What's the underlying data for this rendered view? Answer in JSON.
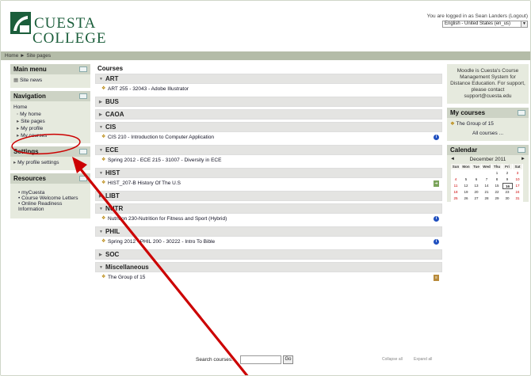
{
  "header": {
    "logo_text": "CUESTA COLLEGE",
    "login_info": "You are logged in as Sean Landers (Logout)",
    "language": "English - United States (en_us)"
  },
  "navbar": {
    "breadcrumb": "Home ► Site pages"
  },
  "main_menu": {
    "title": "Main menu",
    "items": [
      {
        "label": "Site news"
      }
    ]
  },
  "navigation": {
    "title": "Navigation",
    "home": "Home",
    "items": [
      "My home",
      "Site pages",
      "My profile",
      "My courses"
    ]
  },
  "settings": {
    "title": "Settings",
    "items": [
      "My profile settings"
    ]
  },
  "resources": {
    "title": "Resources",
    "items": [
      "myCuesta",
      "Course Welcome Letters",
      "Online Readiness Information"
    ]
  },
  "center": {
    "title": "Courses",
    "categories": [
      {
        "name": "ART",
        "expanded": true,
        "courses": [
          {
            "name": "ART 255 - 32043 - Adobe Illustrator",
            "icon": ""
          }
        ]
      },
      {
        "name": "BUS",
        "expanded": false,
        "courses": []
      },
      {
        "name": "CAOA",
        "expanded": false,
        "courses": []
      },
      {
        "name": "CIS",
        "expanded": true,
        "courses": [
          {
            "name": "CIS 210 - Introduction to Computer Application",
            "icon": "info"
          }
        ]
      },
      {
        "name": "ECE",
        "expanded": true,
        "courses": [
          {
            "name": "Spring 2012 - ECE 215 - 31007 - Diversity in ECE",
            "icon": ""
          }
        ]
      },
      {
        "name": "HIST",
        "expanded": true,
        "courses": [
          {
            "name": "HIST_207-B History Of The U.S",
            "icon": "enrol"
          }
        ]
      },
      {
        "name": "LIBT",
        "expanded": false,
        "courses": []
      },
      {
        "name": "NUTR",
        "expanded": true,
        "courses": [
          {
            "name": "Nutrition 230-Nutrition for Fitness and Sport (Hybrid)",
            "icon": "info"
          }
        ]
      },
      {
        "name": "PHIL",
        "expanded": true,
        "courses": [
          {
            "name": "Spring 2012 - PHIL 200 - 30222 - Intro To Bible",
            "icon": "info"
          }
        ]
      },
      {
        "name": "SOC",
        "expanded": false,
        "courses": []
      },
      {
        "name": "Miscellaneous",
        "expanded": true,
        "courses": [
          {
            "name": "The Group of 15",
            "icon": "doc"
          }
        ]
      }
    ],
    "search_label": "Search courses:",
    "search_value": "",
    "go_label": "Go",
    "collapse_all": "Collapse all",
    "expand_all": "Expand all"
  },
  "notice": {
    "text": "Moodle is Cuesta's Course Management System for Distance Education. For support, please contact support@cuesta.edu"
  },
  "my_courses": {
    "title": "My courses",
    "items": [
      "The Group of 15"
    ],
    "all_courses": "All courses ..."
  },
  "calendar": {
    "title": "Calendar",
    "month": "December 2011",
    "dow": [
      "Sun",
      "Mon",
      "Tue",
      "Wed",
      "Thu",
      "Fri",
      "Sat"
    ],
    "first_weekday_index": 4,
    "days_in_month": 31,
    "today": 16
  },
  "annotation": {
    "arrow_color": "#cc0000",
    "circle_color": "#cc0000"
  },
  "colors": {
    "navbar": "#b4bca8",
    "block_bg": "#e6eade",
    "block_head": "#cdd3c5",
    "logo_green": "#1b5e3b"
  }
}
